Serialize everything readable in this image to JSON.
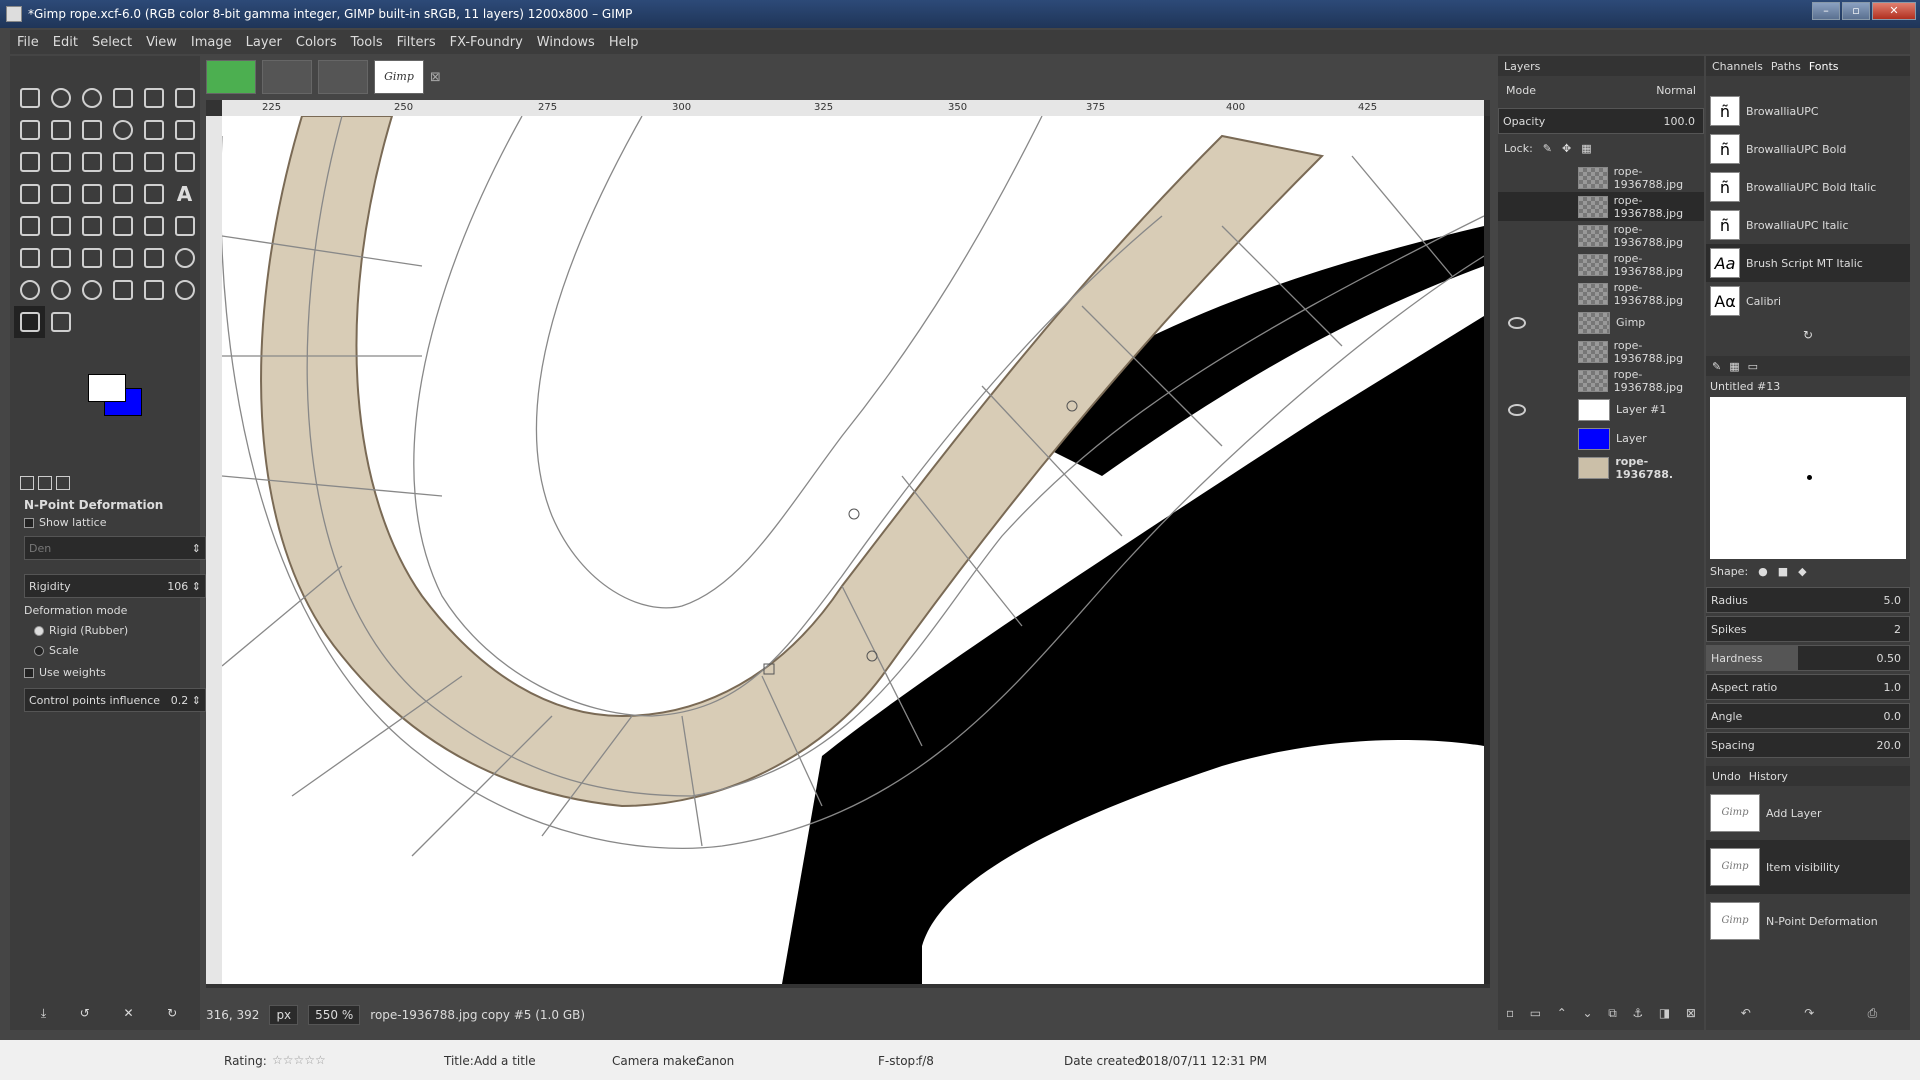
{
  "window": {
    "title": "*Gimp rope.xcf-6.0 (RGB color 8-bit gamma integer, GIMP built-in sRGB, 11 layers) 1200x800 – GIMP"
  },
  "menu": [
    "File",
    "Edit",
    "Select",
    "View",
    "Image",
    "Layer",
    "Colors",
    "Tools",
    "Filters",
    "FX-Foundry",
    "Windows",
    "Help"
  ],
  "image_tabs": {
    "active_label": "Gimp"
  },
  "tool_options": {
    "title": "N-Point Deformation",
    "show_lattice": "Show lattice",
    "density_label": "Den",
    "rigidity_label": "Rigidity",
    "rigidity_value": "106",
    "deformation_mode_label": "Deformation mode",
    "mode_rigid": "Rigid (Rubber)",
    "mode_scale": "Scale",
    "use_weights": "Use weights",
    "cp_influence_label": "Control points influence",
    "cp_influence_value": "0.2"
  },
  "colors": {
    "fg": "#ffffff",
    "bg": "#0000ff"
  },
  "ruler": {
    "ticks": [
      "225",
      "250",
      "275",
      "300",
      "325",
      "350",
      "375",
      "400",
      "425"
    ]
  },
  "status": {
    "coords": "316, 392",
    "unit": "px",
    "zoom": "550 %",
    "layer_info": "rope-1936788.jpg copy #5 (1.0 GB)"
  },
  "layers_panel": {
    "tab": "Layers",
    "mode_label": "Mode",
    "mode_value": "Normal",
    "opacity_label": "Opacity",
    "opacity_value": "100.0",
    "lock_label": "Lock:",
    "layers": [
      {
        "name": "rope-1936788.jpg",
        "visible": false
      },
      {
        "name": "rope-1936788.jpg",
        "visible": false
      },
      {
        "name": "rope-1936788.jpg",
        "visible": false
      },
      {
        "name": "rope-1936788.jpg",
        "visible": false
      },
      {
        "name": "rope-1936788.jpg",
        "visible": false
      },
      {
        "name": "Gimp",
        "visible": true
      },
      {
        "name": "rope-1936788.jpg",
        "visible": false
      },
      {
        "name": "rope-1936788.jpg",
        "visible": false
      },
      {
        "name": "Layer #1",
        "visible": true
      },
      {
        "name": "Layer",
        "visible": false
      },
      {
        "name": "rope-1936788.",
        "visible": false
      }
    ]
  },
  "fonts_panel": {
    "tabs": [
      "Channels",
      "Paths",
      "Fonts"
    ],
    "fonts": [
      {
        "name": "BrowalliaUPC",
        "glyph": "ñ"
      },
      {
        "name": "BrowalliaUPC Bold",
        "glyph": "ñ"
      },
      {
        "name": "BrowalliaUPC Bold Italic",
        "glyph": "ñ"
      },
      {
        "name": "BrowalliaUPC Italic",
        "glyph": "ñ"
      },
      {
        "name": "Brush Script MT Italic",
        "glyph": "Aa"
      },
      {
        "name": "Calibri",
        "glyph": "Aα"
      }
    ]
  },
  "brush_editor": {
    "name": "Untitled #13",
    "shape_label": "Shape:",
    "params": [
      {
        "label": "Radius",
        "value": "5.0"
      },
      {
        "label": "Spikes",
        "value": "2"
      },
      {
        "label": "Hardness",
        "value": "0.50"
      },
      {
        "label": "Aspect ratio",
        "value": "1.0"
      },
      {
        "label": "Angle",
        "value": "0.0"
      },
      {
        "label": "Spacing",
        "value": "20.0"
      }
    ]
  },
  "history_panel": {
    "tabs": [
      "Undo",
      "History"
    ],
    "items": [
      {
        "label": "Add Layer",
        "thumb": "Gimp"
      },
      {
        "label": "Item visibility",
        "thumb": "Gimp"
      },
      {
        "label": "N-Point Deformation",
        "thumb": "Gimp"
      }
    ]
  },
  "explorer_bar": {
    "rating_label": "Rating:",
    "title_label": "Title:",
    "title_value": "Add a title",
    "camera_label": "Camera maker:",
    "camera_value": "Canon",
    "fstop_label": "F-stop:",
    "fstop_value": "f/8",
    "date_label": "Date created:",
    "date_value": "2018/07/11 12:31 PM"
  }
}
